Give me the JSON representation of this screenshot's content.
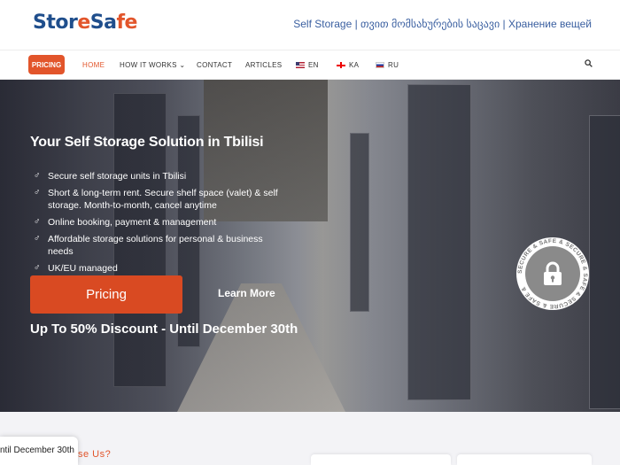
{
  "header": {
    "logo_part1": "Stor",
    "logo_part2": "e",
    "logo_part3": "Sa",
    "logo_part4": "fe",
    "tagline": "Self Storage | თვით მომსახურების საცავი | Хранение вещей"
  },
  "nav": {
    "pricing_pill": "PRICING",
    "home": "HOME",
    "how_it_works": "HOW IT WORKS",
    "contact": "CONTACT",
    "articles": "ARTICLES",
    "lang_en": "EN",
    "lang_ka": "KA",
    "lang_ru": "RU"
  },
  "hero": {
    "title": "Your Self Storage Solution in Tbilisi",
    "bullets": [
      "Secure self storage units in Tbilisi",
      "Short & long-term rent. Secure shelf space (valet) & self storage. Month-to-month, cancel anytime",
      "Online booking, payment & management",
      "Affordable storage solutions for personal & business needs",
      "UK/EU managed"
    ],
    "pricing_button": "Pricing",
    "learn_more": "Learn More",
    "discount": "Up To 50% Discount - Until December 30th",
    "badge_text": "SECURE & SAFE & SECURE & SAFE & SECURE & SAFE &"
  },
  "ticker": {
    "text": "ntil December 30th"
  },
  "section": {
    "heading_fragment": "se Us?"
  },
  "colors": {
    "accent": "#e2552b",
    "brand_blue": "#1f4e8c"
  }
}
